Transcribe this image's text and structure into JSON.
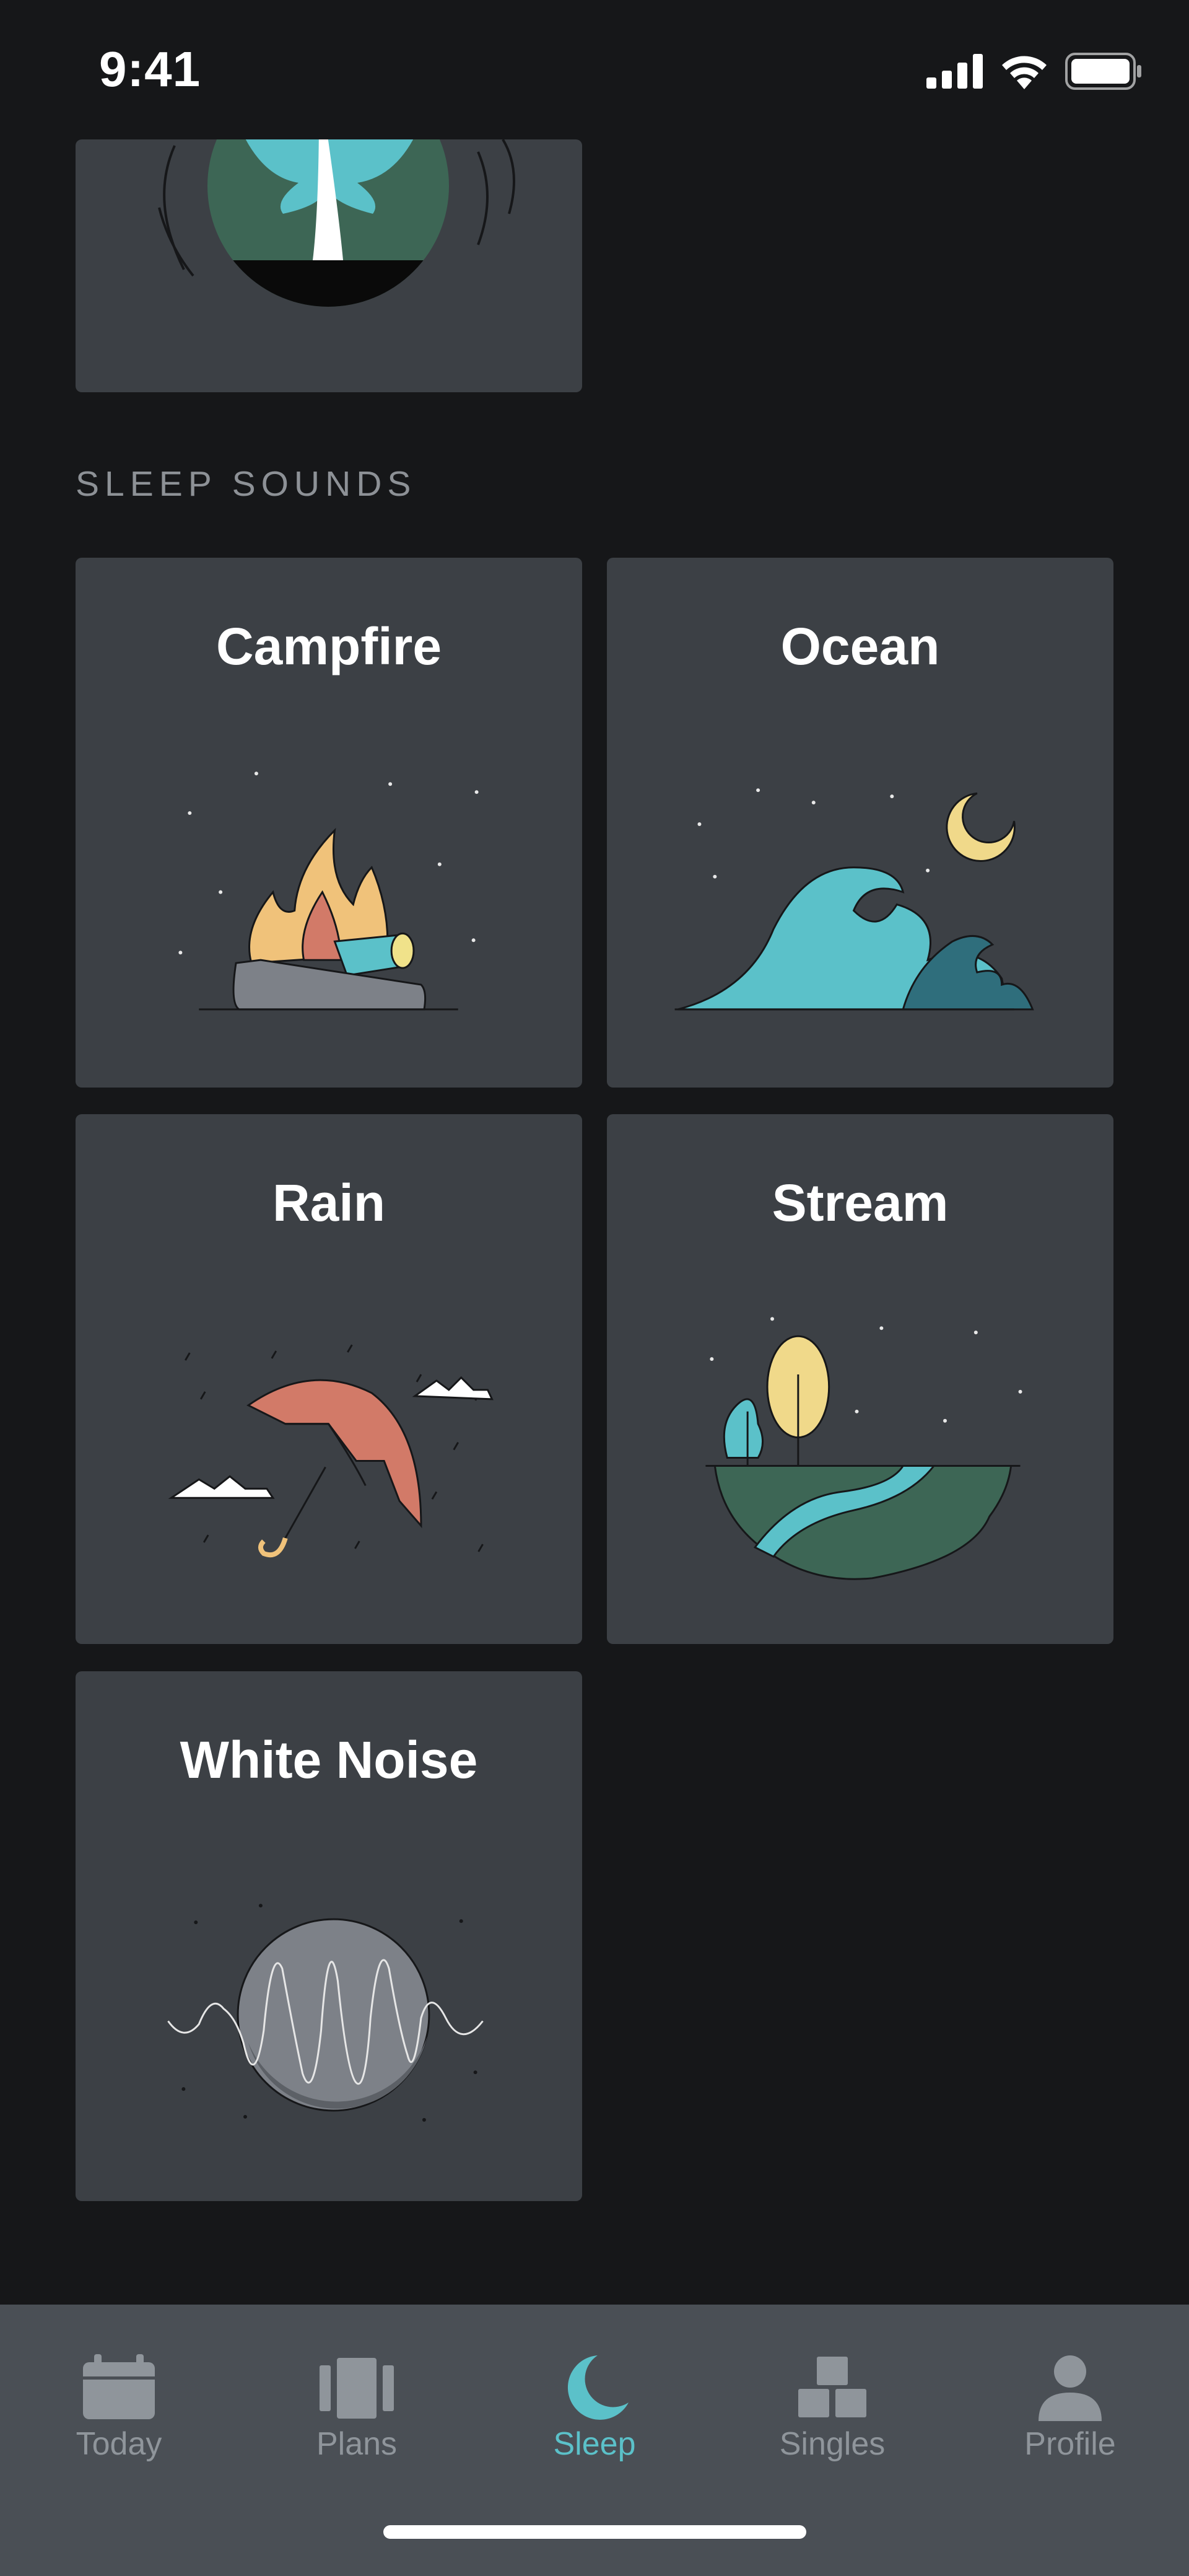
{
  "status": {
    "time": "9:41"
  },
  "section": {
    "title": "SLEEP SOUNDS"
  },
  "cards": [
    {
      "title": "Campfire"
    },
    {
      "title": "Ocean"
    },
    {
      "title": "Rain"
    },
    {
      "title": "Stream"
    },
    {
      "title": "White Noise"
    }
  ],
  "tabs": [
    {
      "label": "Today",
      "icon": "calendar-icon"
    },
    {
      "label": "Plans",
      "icon": "plans-icon"
    },
    {
      "label": "Sleep",
      "icon": "moon-icon",
      "active": true
    },
    {
      "label": "Singles",
      "icon": "blocks-icon"
    },
    {
      "label": "Profile",
      "icon": "person-icon"
    }
  ],
  "colors": {
    "background": "#161719",
    "card": "#3c4045",
    "accent": "#5bc1c9",
    "tab_bar": "#4a4f55",
    "tab_inactive": "#8f959b"
  }
}
